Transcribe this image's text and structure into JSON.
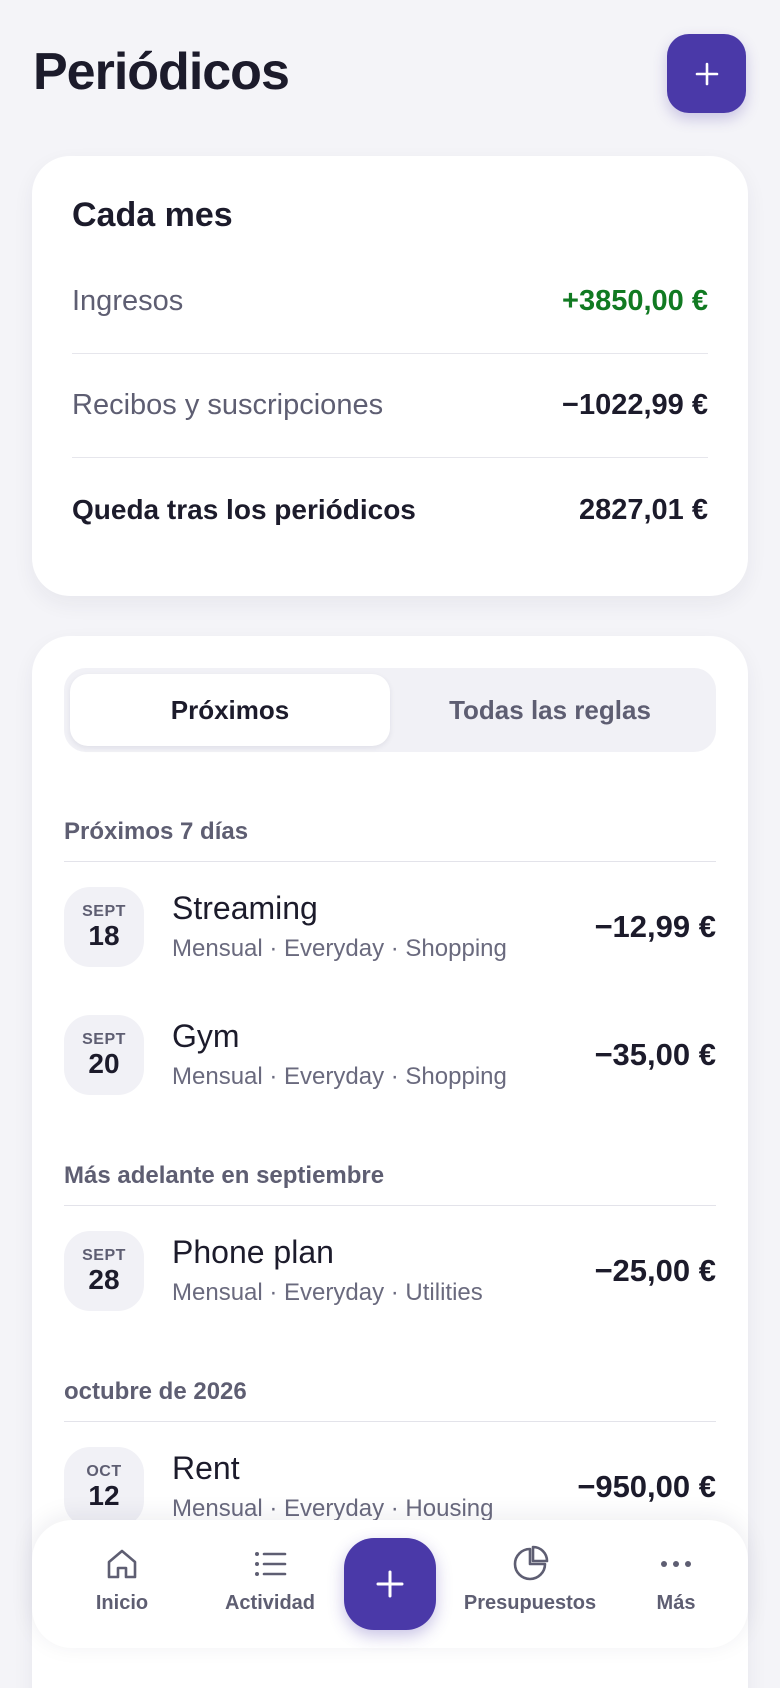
{
  "header": {
    "title": "Periódicos"
  },
  "summary": {
    "title": "Cada mes",
    "rows": [
      {
        "label": "Ingresos",
        "value": "+3850,00 €"
      },
      {
        "label": "Recibos y suscripciones",
        "value": "−1022,99 €"
      },
      {
        "label": "Queda tras los periódicos",
        "value": "2827,01 €"
      }
    ]
  },
  "segments": {
    "upcoming": "Próximos",
    "all_rules": "Todas las reglas",
    "selected": "Próximos"
  },
  "groups": [
    {
      "title": "Próximos 7 días",
      "items": [
        {
          "month": "SEPT",
          "day": "18",
          "name": "Streaming",
          "meta": "Mensual · Everyday · Shopping",
          "amount": "−12,99 €"
        },
        {
          "month": "SEPT",
          "day": "20",
          "name": "Gym",
          "meta": "Mensual · Everyday · Shopping",
          "amount": "−35,00 €"
        }
      ]
    },
    {
      "title": "Más adelante en septiembre",
      "items": [
        {
          "month": "SEPT",
          "day": "28",
          "name": "Phone plan",
          "meta": "Mensual · Everyday · Utilities",
          "amount": "−25,00 €"
        }
      ]
    },
    {
      "title": "octubre de 2026",
      "items": [
        {
          "month": "OCT",
          "day": "12",
          "name": "Rent",
          "meta": "Mensual · Everyday · Housing",
          "amount": "−950,00 €"
        }
      ]
    }
  ],
  "tabbar": {
    "home": "Inicio",
    "activity": "Actividad",
    "budgets": "Presupuestos",
    "more": "Más"
  },
  "colors": {
    "accent": "#4a39a8",
    "positive": "#117a22",
    "background": "#f4f4f8"
  }
}
